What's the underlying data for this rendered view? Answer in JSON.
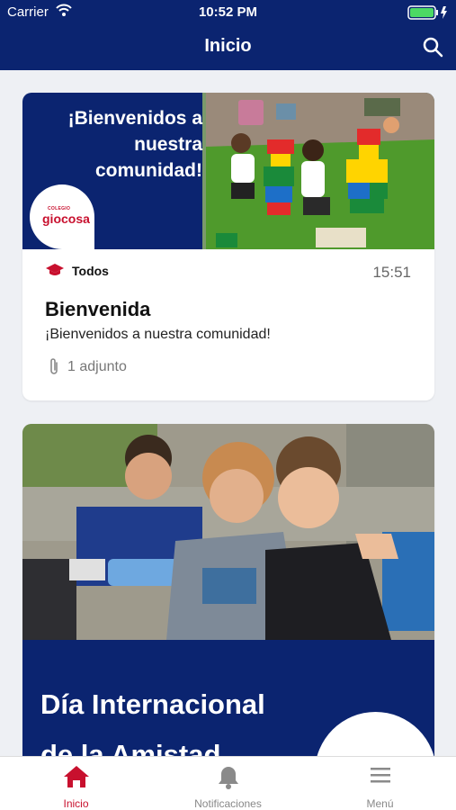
{
  "status_bar": {
    "carrier": "Carrier",
    "time": "10:52 PM"
  },
  "nav": {
    "title": "Inicio"
  },
  "posts": [
    {
      "banner_text": "¡Bienvenidos a nuestra comunidad!",
      "logo_small": "COLEGIO",
      "logo_name": "giocosa",
      "category": "Todos",
      "time": "15:51",
      "title": "Bienvenida",
      "summary": "¡Bienvenidos a nuestra comunidad!",
      "attachments": "1 adjunto"
    },
    {
      "headline": "Día Internacional\nde la Amistad"
    }
  ],
  "tabs": [
    {
      "label": "Inicio",
      "icon": "home-icon",
      "active": true
    },
    {
      "label": "Notificaciones",
      "icon": "bell-icon",
      "active": false
    },
    {
      "label": "Menú",
      "icon": "menu-icon",
      "active": false
    }
  ],
  "colors": {
    "primary": "#0b2470",
    "accent": "#c8102e",
    "background": "#eef0f4"
  }
}
